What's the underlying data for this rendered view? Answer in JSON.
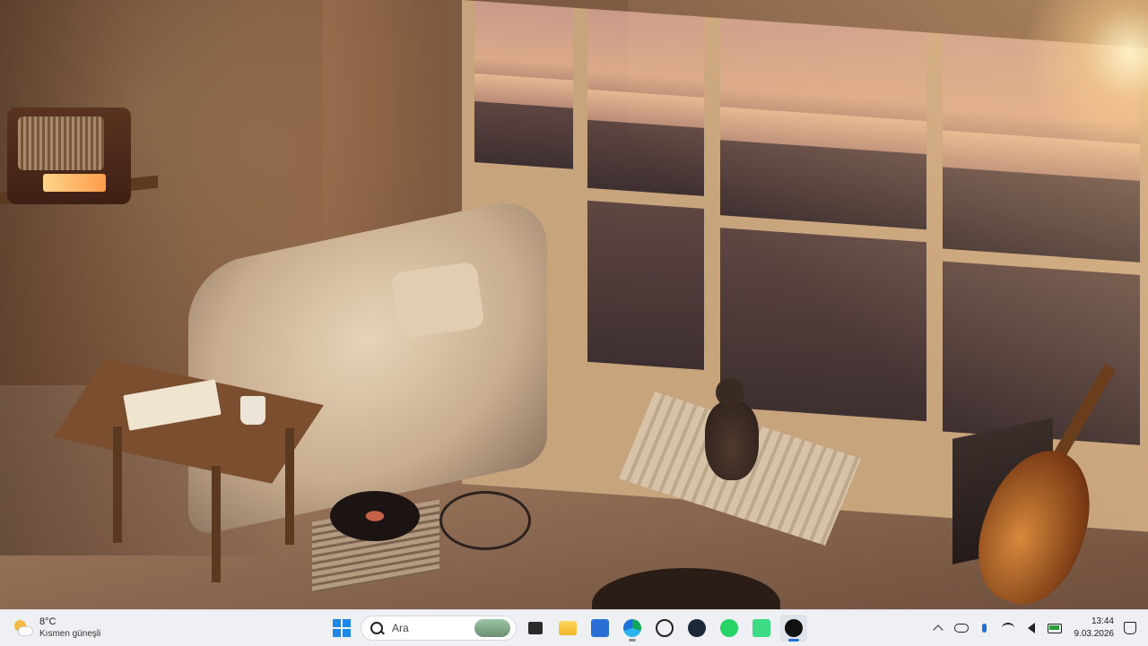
{
  "wallpaper": {
    "scene": "room-with-window-overlooking-harbor-at-sunset"
  },
  "taskbar": {
    "weather": {
      "temperature": "8°C",
      "condition": "Kısmen güneşli",
      "icon": "partly-sunny-icon"
    },
    "start": {
      "icon": "windows-logo-icon"
    },
    "search": {
      "placeholder": "Ara",
      "icon": "search-icon"
    },
    "pinned_apps": [
      {
        "name": "task-view",
        "icon": "task-view-icon",
        "running": false
      },
      {
        "name": "file-explorer",
        "icon": "folder-icon",
        "running": false
      },
      {
        "name": "outlook",
        "icon": "outlook-icon",
        "running": false
      },
      {
        "name": "edge",
        "icon": "edge-icon",
        "running": true
      },
      {
        "name": "chatgpt",
        "icon": "chatgpt-icon",
        "running": false
      },
      {
        "name": "steam",
        "icon": "steam-icon",
        "running": false
      },
      {
        "name": "whatsapp",
        "icon": "whatsapp-icon",
        "running": false
      },
      {
        "name": "android-app",
        "icon": "android-icon",
        "running": false
      },
      {
        "name": "obs-studio",
        "icon": "obs-icon",
        "running": true
      }
    ],
    "tray": {
      "icons": [
        "chevron-up-icon",
        "onedrive-icon",
        "microphone-icon",
        "wifi-icon",
        "speaker-icon",
        "battery-icon"
      ],
      "time": "13:44",
      "date": "9.03.2026",
      "notification_icon": "notification-bell-icon"
    },
    "colors": {
      "background": "#eef0f4",
      "accent": "#1e6fd9"
    }
  }
}
